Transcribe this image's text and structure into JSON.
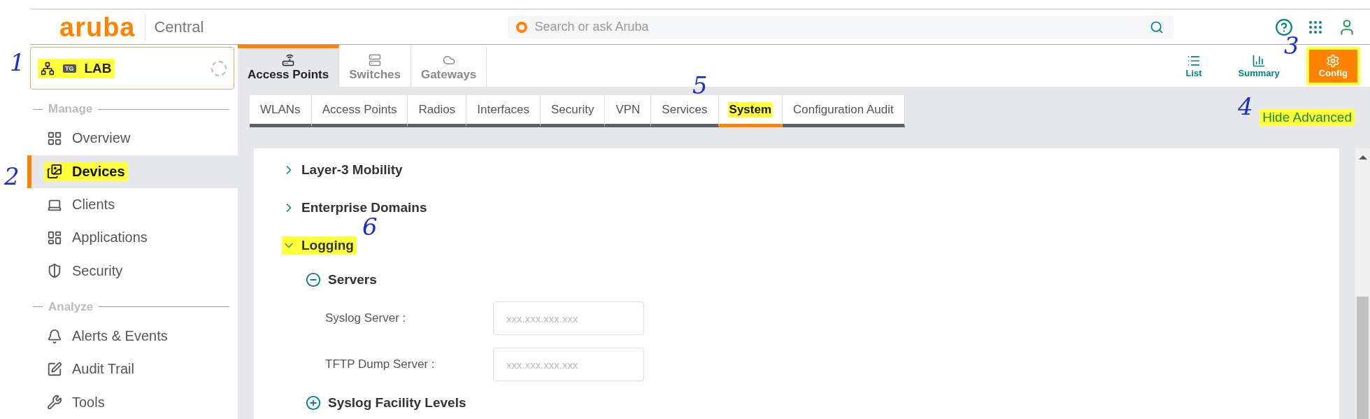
{
  "header": {
    "logo": "aruba",
    "product": "Central",
    "search": {
      "placeholder": "Search or ask Aruba"
    }
  },
  "sidebar": {
    "group": {
      "tag": "TG",
      "label": "LAB",
      "highlighted": true
    },
    "sections": [
      {
        "title": "Manage",
        "items": [
          {
            "label": "Overview",
            "selected": false,
            "highlighted": false
          },
          {
            "label": "Devices",
            "selected": true,
            "highlighted": true
          },
          {
            "label": "Clients",
            "selected": false,
            "highlighted": false
          },
          {
            "label": "Applications",
            "selected": false,
            "highlighted": false
          },
          {
            "label": "Security",
            "selected": false,
            "highlighted": false
          }
        ]
      },
      {
        "title": "Analyze",
        "items": [
          {
            "label": "Alerts & Events",
            "selected": false,
            "highlighted": false
          },
          {
            "label": "Audit Trail",
            "selected": false,
            "highlighted": false
          },
          {
            "label": "Tools",
            "selected": false,
            "highlighted": false
          }
        ]
      }
    ]
  },
  "device_tabs": [
    {
      "label": "Access Points",
      "selected": true
    },
    {
      "label": "Switches",
      "selected": false
    },
    {
      "label": "Gateways",
      "selected": false
    }
  ],
  "views": [
    {
      "label": "List",
      "selected": false,
      "highlighted": false
    },
    {
      "label": "Summary",
      "selected": false,
      "highlighted": false
    },
    {
      "label": "Config",
      "selected": true,
      "highlighted": true
    }
  ],
  "config_tabs": [
    {
      "label": "WLANs",
      "selected": false,
      "highlighted": false
    },
    {
      "label": "Access Points",
      "selected": false,
      "highlighted": false
    },
    {
      "label": "Radios",
      "selected": false,
      "highlighted": false
    },
    {
      "label": "Interfaces",
      "selected": false,
      "highlighted": false
    },
    {
      "label": "Security",
      "selected": false,
      "highlighted": false
    },
    {
      "label": "VPN",
      "selected": false,
      "highlighted": false
    },
    {
      "label": "Services",
      "selected": false,
      "highlighted": false
    },
    {
      "label": "System",
      "selected": true,
      "highlighted": true
    },
    {
      "label": "Configuration Audit",
      "selected": false,
      "highlighted": false
    }
  ],
  "hide_advanced": {
    "label": "Hide Advanced",
    "highlighted": true
  },
  "sections": [
    {
      "title": "Layer-3 Mobility",
      "expanded": false,
      "highlighted": false
    },
    {
      "title": "Enterprise Domains",
      "expanded": false,
      "highlighted": false
    },
    {
      "title": "Logging",
      "expanded": true,
      "highlighted": true,
      "groups": [
        {
          "title": "Servers",
          "expanded": true,
          "fields": [
            {
              "label": "Syslog Server :",
              "placeholder": "xxx.xxx.xxx.xxx"
            },
            {
              "label": "TFTP Dump Server :",
              "placeholder": "xxx.xxx.xxx.xxx"
            }
          ]
        },
        {
          "title": "Syslog Facility Levels",
          "expanded": false
        }
      ]
    }
  ],
  "annotations": [
    "1",
    "2",
    "3",
    "4",
    "5",
    "6"
  ]
}
